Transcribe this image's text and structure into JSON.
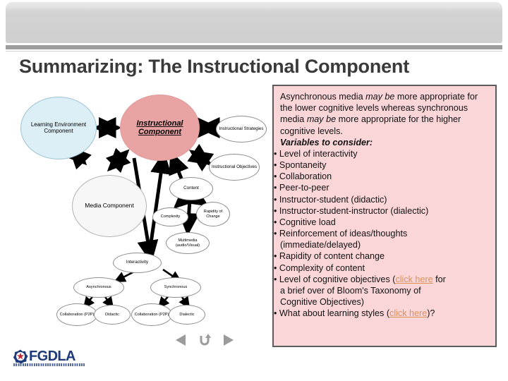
{
  "slide": {
    "title": "Summarizing: The Instructional Component"
  },
  "diagram": {
    "nodes": {
      "learning_environment": "Learning Environment Component",
      "instructional_component": "Instructional Component",
      "instructional_strategies": "Instructional Strategies",
      "instructional_objectives": "Instructional Objectives",
      "media_component": "Media Component",
      "content": "Content",
      "complexity": "Complexity",
      "rapidity_of_change": "Rapidity of Change",
      "multimedia": "Multimedia (audio/Visual)",
      "interactivity": "Interactivity",
      "asynchronous": "Asynchronous",
      "synchronous": "Synchronous",
      "async_collaboration": "Collaboration (P2P)",
      "async_didactic": "Didactic",
      "sync_collaboration": "Collaboration (P2P)",
      "sync_dialectic": "Dialectic"
    },
    "colors": {
      "learning_environment_fill": "#dceff6",
      "instructional_component_fill": "#e9a3a3",
      "media_component_fill": "#f7f7f7",
      "ellipse_stroke": "#8d8d8d",
      "arrow": "#000000"
    }
  },
  "panel": {
    "intro": {
      "part1": "Asynchronous media ",
      "em1": "may be",
      "part2": " more appropriate for the lower cognitive levels whereas synchronous media ",
      "em2": "may be",
      "part3": " more appropriate for the higher cognitive levels."
    },
    "lead": "Variables to consider:",
    "bullets": [
      {
        "level": 1,
        "text": "Level of interactivity"
      },
      {
        "level": 2,
        "text": "Spontaneity"
      },
      {
        "level": 2,
        "text": "Collaboration"
      },
      {
        "level": 2,
        "text": "Peer-to-peer"
      },
      {
        "level": 2,
        "text": "Instructor-student (didactic)"
      },
      {
        "level": 2,
        "text": "Instructor-student-instructor (dialectic)"
      },
      {
        "level": 1,
        "text": "Cognitive load"
      },
      {
        "level": 1,
        "text": "Reinforcement of ideas/thoughts"
      },
      {
        "level": 0,
        "text": "(immediate/delayed)"
      },
      {
        "level": 1,
        "text": "Rapidity of content change"
      },
      {
        "level": 1,
        "text": "Complexity of content"
      }
    ],
    "objectives_bullet": {
      "before": "Level of cognitive objectives (",
      "link": "click here",
      "after": " for"
    },
    "objectives_cont": "a brief over of Bloom's Taxonomy of",
    "objectives_cont2": "Cognitive Objectives)",
    "styles_bullet": {
      "before": "What about learning styles (",
      "link": "click here",
      "after": ")?"
    },
    "colors": {
      "background": "#fbd6d9",
      "border": "#5b5b5b",
      "link": "#d9925c"
    }
  },
  "footer": {
    "logo_word": "FGDLA",
    "nav": {
      "previous": "previous-slide",
      "return": "return",
      "next": "next-slide"
    }
  }
}
